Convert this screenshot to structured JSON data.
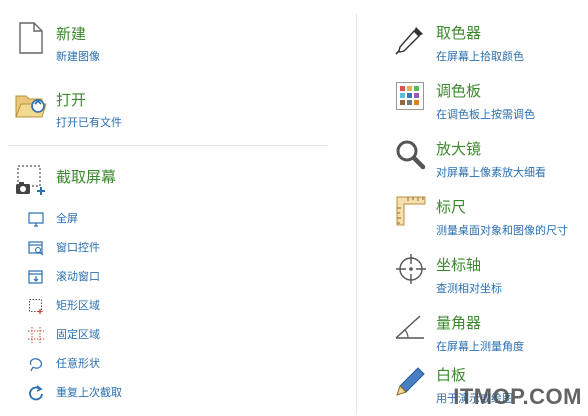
{
  "left": {
    "new": {
      "title": "新建",
      "subtitle": "新建图像"
    },
    "open": {
      "title": "打开",
      "subtitle": "打开已有文件"
    },
    "capture": {
      "title": "截取屏幕",
      "items": [
        {
          "label": "全屏",
          "icon": "monitor-icon"
        },
        {
          "label": "窗口控件",
          "icon": "window-control-icon"
        },
        {
          "label": "滚动窗口",
          "icon": "scroll-window-icon"
        },
        {
          "label": "矩形区域",
          "icon": "rectangle-region-icon"
        },
        {
          "label": "固定区域",
          "icon": "fixed-region-icon"
        },
        {
          "label": "任意形状",
          "icon": "freeform-icon"
        },
        {
          "label": "重复上次截取",
          "icon": "repeat-icon"
        }
      ]
    }
  },
  "right": {
    "tools": [
      {
        "title": "取色器",
        "subtitle": "在屏幕上拾取颜色",
        "icon": "eyedropper-icon"
      },
      {
        "title": "调色板",
        "subtitle": "在调色板上按需调色",
        "icon": "palette-icon"
      },
      {
        "title": "放大镜",
        "subtitle": "对屏幕上像素放大细看",
        "icon": "magnifier-icon"
      },
      {
        "title": "标尺",
        "subtitle": "测量桌面对象和图像的尺寸",
        "icon": "ruler-icon"
      },
      {
        "title": "坐标轴",
        "subtitle": "查测相对坐标",
        "icon": "crosshair-icon"
      },
      {
        "title": "量角器",
        "subtitle": "在屏幕上测量角度",
        "icon": "protractor-icon"
      },
      {
        "title": "白板",
        "subtitle": "用于演示或绘图",
        "icon": "pen-icon"
      }
    ]
  },
  "watermark": "ITMOP.COM"
}
